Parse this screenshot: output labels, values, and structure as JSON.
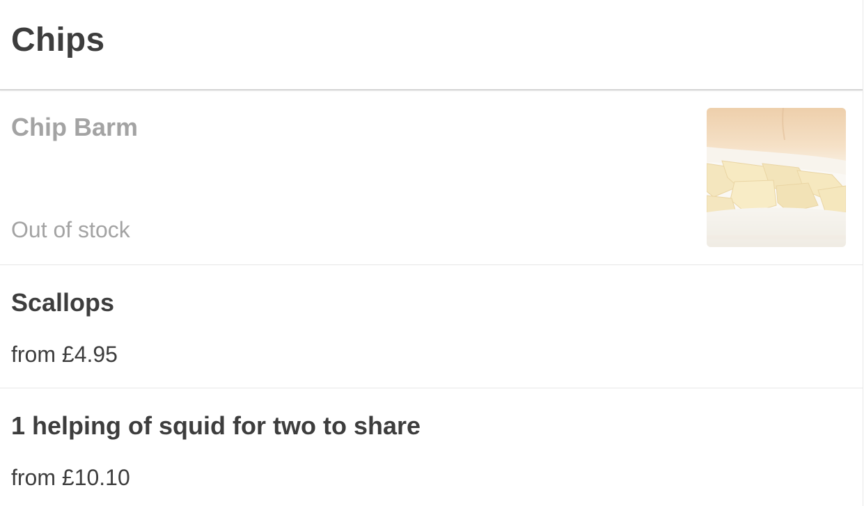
{
  "section": {
    "title": "Chips"
  },
  "items": [
    {
      "name": "Chip Barm",
      "status": "Out of stock",
      "image_icon": "chip-barm-photo"
    },
    {
      "name": "Scallops",
      "price": "from £4.95"
    },
    {
      "name": "1 helping of squid for two to share",
      "price": "from £10.10"
    }
  ]
}
